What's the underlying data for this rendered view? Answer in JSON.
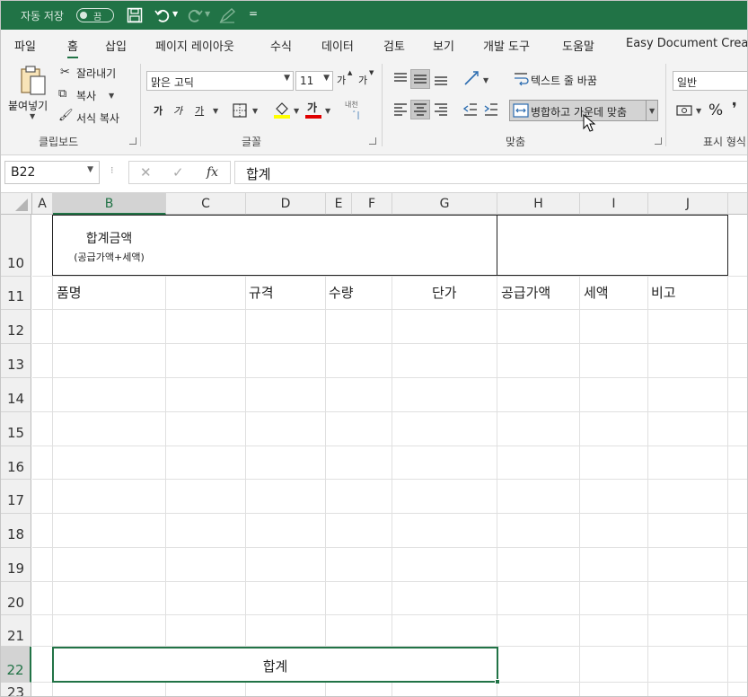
{
  "titlebar": {
    "autosave_label": "자동 저장",
    "autosave_state": "끔",
    "qat_more": "="
  },
  "menu": {
    "tabs": [
      "파일",
      "홈",
      "삽입",
      "페이지 레이아웃",
      "수식",
      "데이터",
      "검토",
      "보기",
      "개발 도구",
      "도움말",
      "Easy Document Creator"
    ],
    "active": "홈"
  },
  "ribbon": {
    "clipboard": {
      "paste": "붙여넣기",
      "cut": "잘라내기",
      "copy": "복사",
      "format_painter": "서식 복사",
      "group": "클립보드"
    },
    "font": {
      "name": "맑은 고딕",
      "size": "11",
      "grow": "가",
      "shrink": "가",
      "bold": "가",
      "italic": "가",
      "underline": "가",
      "font_color": "가",
      "phonetic": "내천",
      "group": "글꼴"
    },
    "alignment": {
      "wrap_text": "텍스트 줄 바꿈",
      "merge_center": "병합하고 가운데 맞춤",
      "group": "맞춤"
    },
    "number": {
      "format": "일반",
      "percent": "%",
      "group": "표시 형식"
    }
  },
  "formula_bar": {
    "name_box": "B22",
    "fx": "fx",
    "cancel": "✕",
    "enter": "✓",
    "content": "합계"
  },
  "grid": {
    "columns": [
      "A",
      "B",
      "C",
      "D",
      "E",
      "F",
      "G",
      "H",
      "I",
      "J"
    ],
    "selected_column": "B",
    "rows": [
      "10",
      "11",
      "12",
      "13",
      "14",
      "15",
      "16",
      "17",
      "18",
      "19",
      "20",
      "21",
      "22",
      "23"
    ],
    "selected_row": "22",
    "cells": {
      "b10_line1": "합계금액",
      "b10_line2": "(공급가액+세액)",
      "b11": "품명",
      "d11": "규격",
      "e11": "수량",
      "g11": "단가",
      "h11": "공급가액",
      "i11": "세액",
      "j11": "비고",
      "b22": "합계"
    }
  },
  "colors": {
    "excel_green": "#217346",
    "ribbon_bg": "#f3f3f3",
    "header_bg": "#f0f0f0"
  }
}
